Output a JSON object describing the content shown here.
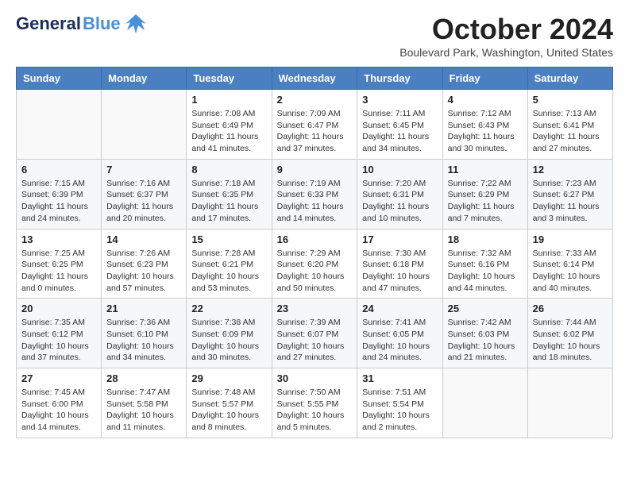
{
  "logo": {
    "general": "General",
    "blue": "Blue"
  },
  "title": "October 2024",
  "location": "Boulevard Park, Washington, United States",
  "days_of_week": [
    "Sunday",
    "Monday",
    "Tuesday",
    "Wednesday",
    "Thursday",
    "Friday",
    "Saturday"
  ],
  "weeks": [
    [
      {
        "day": "",
        "content": ""
      },
      {
        "day": "",
        "content": ""
      },
      {
        "day": "1",
        "content": "Sunrise: 7:08 AM\nSunset: 6:49 PM\nDaylight: 11 hours and 41 minutes."
      },
      {
        "day": "2",
        "content": "Sunrise: 7:09 AM\nSunset: 6:47 PM\nDaylight: 11 hours and 37 minutes."
      },
      {
        "day": "3",
        "content": "Sunrise: 7:11 AM\nSunset: 6:45 PM\nDaylight: 11 hours and 34 minutes."
      },
      {
        "day": "4",
        "content": "Sunrise: 7:12 AM\nSunset: 6:43 PM\nDaylight: 11 hours and 30 minutes."
      },
      {
        "day": "5",
        "content": "Sunrise: 7:13 AM\nSunset: 6:41 PM\nDaylight: 11 hours and 27 minutes."
      }
    ],
    [
      {
        "day": "6",
        "content": "Sunrise: 7:15 AM\nSunset: 6:39 PM\nDaylight: 11 hours and 24 minutes."
      },
      {
        "day": "7",
        "content": "Sunrise: 7:16 AM\nSunset: 6:37 PM\nDaylight: 11 hours and 20 minutes."
      },
      {
        "day": "8",
        "content": "Sunrise: 7:18 AM\nSunset: 6:35 PM\nDaylight: 11 hours and 17 minutes."
      },
      {
        "day": "9",
        "content": "Sunrise: 7:19 AM\nSunset: 6:33 PM\nDaylight: 11 hours and 14 minutes."
      },
      {
        "day": "10",
        "content": "Sunrise: 7:20 AM\nSunset: 6:31 PM\nDaylight: 11 hours and 10 minutes."
      },
      {
        "day": "11",
        "content": "Sunrise: 7:22 AM\nSunset: 6:29 PM\nDaylight: 11 hours and 7 minutes."
      },
      {
        "day": "12",
        "content": "Sunrise: 7:23 AM\nSunset: 6:27 PM\nDaylight: 11 hours and 3 minutes."
      }
    ],
    [
      {
        "day": "13",
        "content": "Sunrise: 7:25 AM\nSunset: 6:25 PM\nDaylight: 11 hours and 0 minutes."
      },
      {
        "day": "14",
        "content": "Sunrise: 7:26 AM\nSunset: 6:23 PM\nDaylight: 10 hours and 57 minutes."
      },
      {
        "day": "15",
        "content": "Sunrise: 7:28 AM\nSunset: 6:21 PM\nDaylight: 10 hours and 53 minutes."
      },
      {
        "day": "16",
        "content": "Sunrise: 7:29 AM\nSunset: 6:20 PM\nDaylight: 10 hours and 50 minutes."
      },
      {
        "day": "17",
        "content": "Sunrise: 7:30 AM\nSunset: 6:18 PM\nDaylight: 10 hours and 47 minutes."
      },
      {
        "day": "18",
        "content": "Sunrise: 7:32 AM\nSunset: 6:16 PM\nDaylight: 10 hours and 44 minutes."
      },
      {
        "day": "19",
        "content": "Sunrise: 7:33 AM\nSunset: 6:14 PM\nDaylight: 10 hours and 40 minutes."
      }
    ],
    [
      {
        "day": "20",
        "content": "Sunrise: 7:35 AM\nSunset: 6:12 PM\nDaylight: 10 hours and 37 minutes."
      },
      {
        "day": "21",
        "content": "Sunrise: 7:36 AM\nSunset: 6:10 PM\nDaylight: 10 hours and 34 minutes."
      },
      {
        "day": "22",
        "content": "Sunrise: 7:38 AM\nSunset: 6:09 PM\nDaylight: 10 hours and 30 minutes."
      },
      {
        "day": "23",
        "content": "Sunrise: 7:39 AM\nSunset: 6:07 PM\nDaylight: 10 hours and 27 minutes."
      },
      {
        "day": "24",
        "content": "Sunrise: 7:41 AM\nSunset: 6:05 PM\nDaylight: 10 hours and 24 minutes."
      },
      {
        "day": "25",
        "content": "Sunrise: 7:42 AM\nSunset: 6:03 PM\nDaylight: 10 hours and 21 minutes."
      },
      {
        "day": "26",
        "content": "Sunrise: 7:44 AM\nSunset: 6:02 PM\nDaylight: 10 hours and 18 minutes."
      }
    ],
    [
      {
        "day": "27",
        "content": "Sunrise: 7:45 AM\nSunset: 6:00 PM\nDaylight: 10 hours and 14 minutes."
      },
      {
        "day": "28",
        "content": "Sunrise: 7:47 AM\nSunset: 5:58 PM\nDaylight: 10 hours and 11 minutes."
      },
      {
        "day": "29",
        "content": "Sunrise: 7:48 AM\nSunset: 5:57 PM\nDaylight: 10 hours and 8 minutes."
      },
      {
        "day": "30",
        "content": "Sunrise: 7:50 AM\nSunset: 5:55 PM\nDaylight: 10 hours and 5 minutes."
      },
      {
        "day": "31",
        "content": "Sunrise: 7:51 AM\nSunset: 5:54 PM\nDaylight: 10 hours and 2 minutes."
      },
      {
        "day": "",
        "content": ""
      },
      {
        "day": "",
        "content": ""
      }
    ]
  ]
}
